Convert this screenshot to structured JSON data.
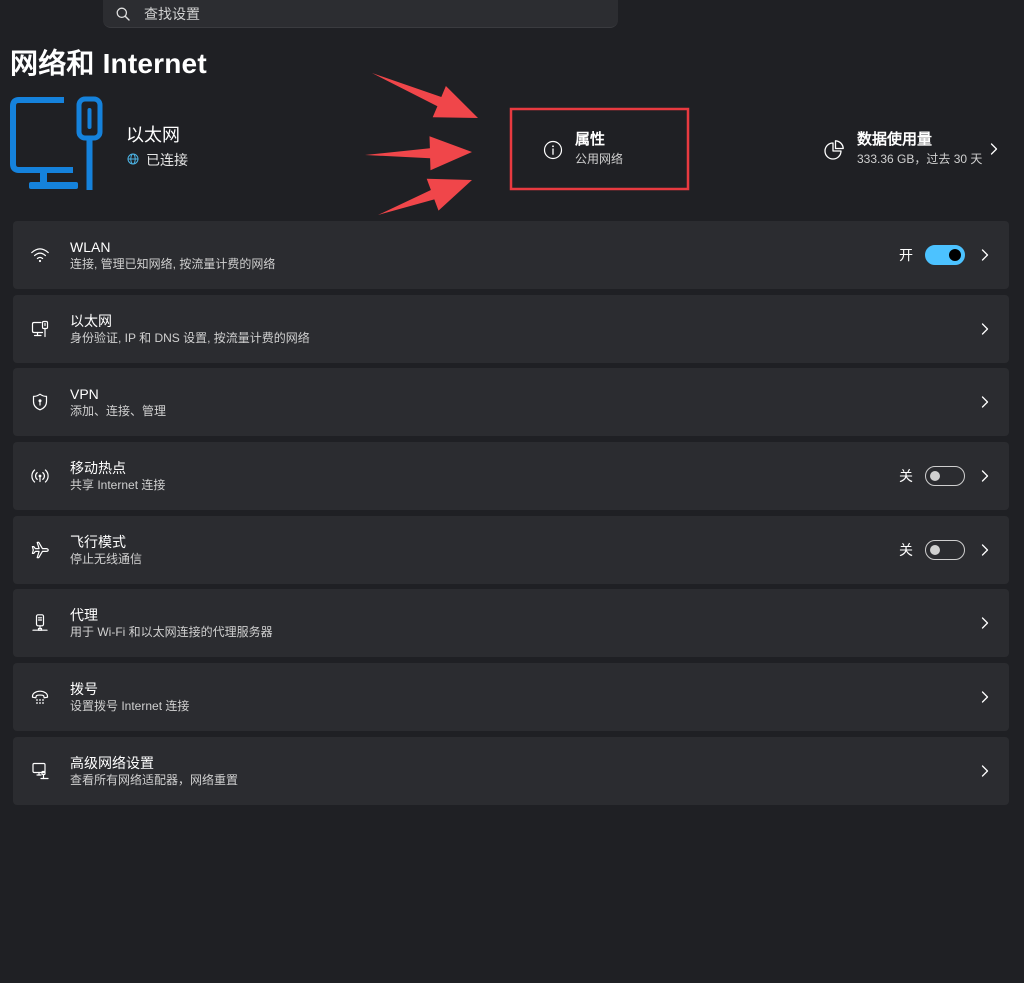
{
  "search": {
    "placeholder": "查找设置",
    "icon": "search-icon"
  },
  "page": {
    "title": "网络和 Internet"
  },
  "hero": {
    "icon": "ethernet-monitor-icon",
    "name": "以太网",
    "status": "已连接",
    "status_icon": "globe-icon",
    "properties": {
      "icon": "info-icon",
      "label": "属性",
      "value": "公用网络"
    },
    "data_usage": {
      "icon": "pie-chart-icon",
      "label": "数据使用量",
      "value": "333.36 GB，过去 30 天"
    }
  },
  "items": [
    {
      "icon": "wifi-icon",
      "title": "WLAN",
      "subtitle": "连接, 管理已知网络, 按流量计费的网络",
      "toggle": {
        "label": "开",
        "on": true
      }
    },
    {
      "icon": "ethernet-icon",
      "title": "以太网",
      "subtitle": "身份验证, IP 和 DNS 设置, 按流量计费的网络"
    },
    {
      "icon": "shield-icon",
      "title": "VPN",
      "subtitle": "添加、连接、管理"
    },
    {
      "icon": "hotspot-icon",
      "title": "移动热点",
      "subtitle": "共享 Internet 连接",
      "toggle": {
        "label": "关",
        "on": false
      }
    },
    {
      "icon": "airplane-icon",
      "title": "飞行模式",
      "subtitle": "停止无线通信",
      "toggle": {
        "label": "关",
        "on": false
      }
    },
    {
      "icon": "proxy-icon",
      "title": "代理",
      "subtitle": "用于 Wi-Fi 和以太网连接的代理服务器"
    },
    {
      "icon": "dialup-icon",
      "title": "拨号",
      "subtitle": "设置拨号 Internet 连接"
    },
    {
      "icon": "advanced-network-icon",
      "title": "高级网络设置",
      "subtitle": "查看所有网络适配器，网络重置"
    }
  ],
  "colors": {
    "background": "#1f2024",
    "card": "#2b2c30",
    "accent": "#4cc2ff",
    "hero_icon": "#1582dc",
    "status_globe": "#4cb4e6",
    "annotation": "#f0464a",
    "annotation_box": "#e83a40"
  }
}
